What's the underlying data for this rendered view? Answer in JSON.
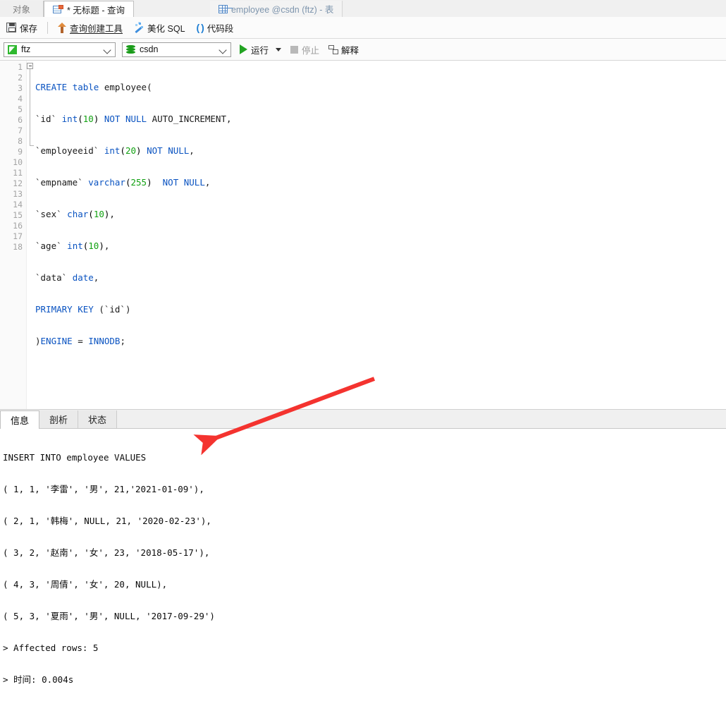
{
  "tabs": [
    {
      "label": "对象",
      "icon": "none",
      "state": "inactive-plain"
    },
    {
      "label": "* 无标题 - 查询",
      "icon": "query-icon",
      "state": "active"
    },
    {
      "label": "employee @csdn (ftz) - 表",
      "icon": "grid-icon",
      "state": "inactive"
    }
  ],
  "toolbar": {
    "save_label": "保存",
    "query_builder_label": "查询创建工具",
    "beautify_sql_label": "美化 SQL",
    "code_snippet_label": "代码段"
  },
  "connbar": {
    "connection_value": "ftz",
    "database_value": "csdn",
    "run_label": "运行",
    "stop_label": "停止",
    "explain_label": "解释"
  },
  "editor": {
    "line_numbers": [
      "1",
      "2",
      "3",
      "4",
      "5",
      "6",
      "7",
      "8",
      "9",
      "10",
      "11",
      "12",
      "13",
      "14",
      "15",
      "16",
      "17",
      "18"
    ],
    "code_lines": [
      "CREATE table employee(",
      "`id` int(10) NOT NULL AUTO_INCREMENT,",
      "`employeeid` int(20) NOT NULL,",
      "`empname` varchar(255)  NOT NULL,",
      "`sex` char(10),",
      "`age` int(10),",
      "`data` date,",
      "PRIMARY KEY (`id`)",
      ")ENGINE = INNODB;",
      "",
      "",
      "INSERT INTO employee VALUES",
      "( 1, 1, '李雷', '男', 21,'2021-01-09'),",
      "( 2, 1, '韩梅', NULL, 21, '2020-02-23'),",
      "( 3, 2, '赵南', '女', 23, '2018-05-17'),",
      "( 4, 3, '周倩', '女', 20, NULL),",
      "( 5, 3, '夏雨', '男', NULL, '2017-09-29');",
      ""
    ]
  },
  "results": {
    "tabs": [
      {
        "label": "信息",
        "active": true
      },
      {
        "label": "剖析",
        "active": false
      },
      {
        "label": "状态",
        "active": false
      }
    ],
    "output_lines": [
      "INSERT INTO employee VALUES",
      "( 1, 1, '李雷', '男', 21,'2021-01-09'),",
      "( 2, 1, '韩梅', NULL, 21, '2020-02-23'),",
      "( 3, 2, '赵南', '女', 23, '2018-05-17'),",
      "( 4, 3, '周倩', '女', 20, NULL),",
      "( 5, 3, '夏雨', '男', NULL, '2017-09-29')",
      "> Affected rows: 5",
      "> 时间: 0.004s"
    ],
    "affected_rows": "5",
    "time": "0.004s"
  },
  "annotation": {
    "arrow_color": "#f4332f"
  },
  "colors": {
    "keyword": "#0a53c1",
    "number": "#12a112",
    "string": "#f2246f",
    "accent_green": "#22a322",
    "arrow_red": "#f4332f"
  }
}
